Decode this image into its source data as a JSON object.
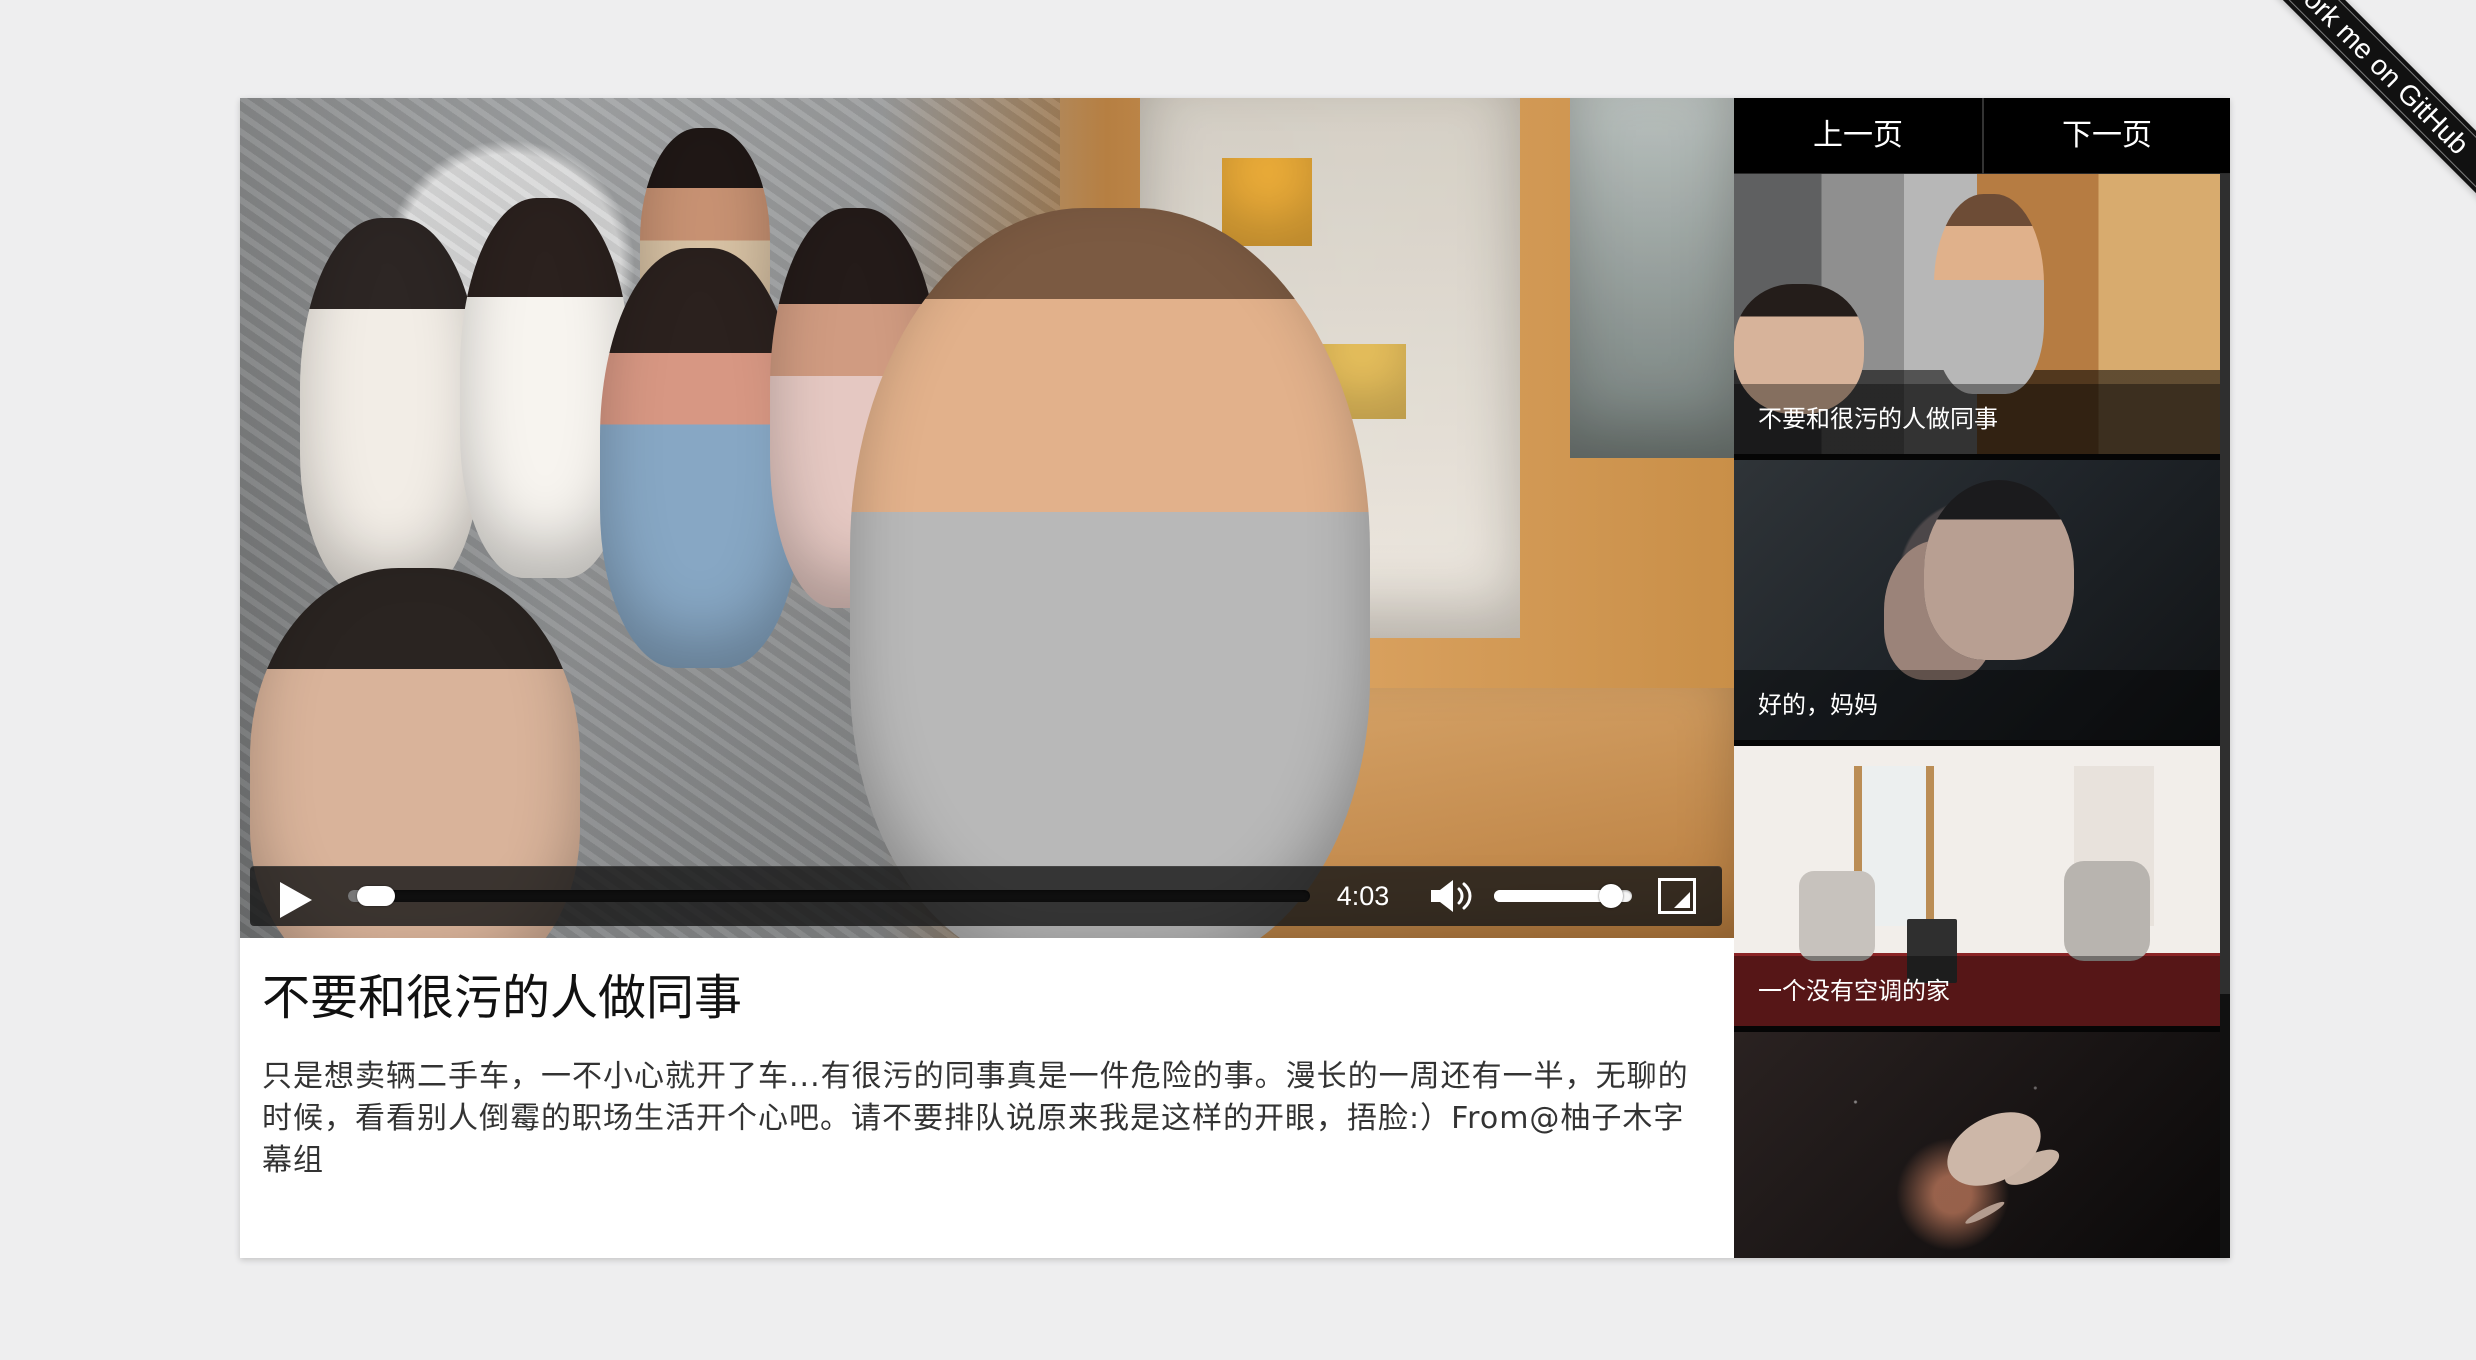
{
  "video": {
    "title": "不要和很污的人做同事",
    "description": "只是想卖辆二手车，一不小心就开了车...有很污的同事真是一件危险的事。漫长的一周还有一半，无聊的时候，看看别人倒霉的职场生活开个心吧。请不要排队说原来我是这样的开眼，捂脸:）From@柚子木字幕组",
    "duration": "4:03",
    "progress": 0.02,
    "volume": 0.85
  },
  "sidebar": {
    "pager": {
      "previous_label": "上一页",
      "next_label": "下一页"
    },
    "items": [
      {
        "label": "不要和很污的人做同事",
        "thumbnail": "office-scene"
      },
      {
        "label": "好的，妈妈",
        "thumbnail": "phone-call-scene"
      },
      {
        "label": "一个没有空调的家",
        "thumbnail": "living-room-scene"
      },
      {
        "label": "",
        "thumbnail": "space-scene"
      }
    ]
  },
  "ribbon": {
    "label": "Fork me on GitHub"
  },
  "colors": {
    "page_background": "#eeeeef",
    "sidebar_background": "#050505",
    "control_bar": "#191919",
    "text_primary": "#111111",
    "text_secondary": "#333333",
    "ribbon": "#111111"
  },
  "icons": {
    "play": "play-icon",
    "volume": "volume-icon",
    "fullscreen": "fullscreen-icon"
  }
}
